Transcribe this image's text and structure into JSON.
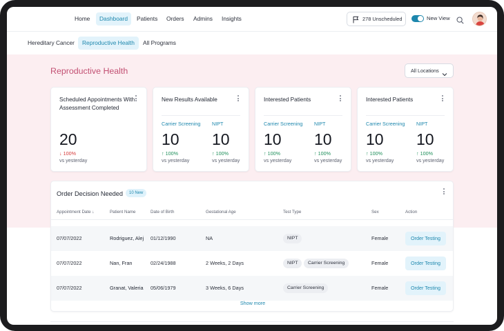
{
  "nav": {
    "items": [
      {
        "label": "Home",
        "active": false
      },
      {
        "label": "Dashboard",
        "active": true
      },
      {
        "label": "Patients",
        "active": false
      },
      {
        "label": "Orders",
        "active": false
      },
      {
        "label": "Admins",
        "active": false
      },
      {
        "label": "Insights",
        "active": false
      }
    ],
    "unscheduled_label": "278 Unscheduled",
    "unscheduled_icon": "flag-icon",
    "toggle": {
      "label": "New View",
      "on": true
    },
    "search_icon": "search-icon",
    "avatar_icon": "user-avatar"
  },
  "programs": {
    "tabs": [
      {
        "label": "Hereditary Cancer",
        "active": false
      },
      {
        "label": "Reproductive Health",
        "active": true
      },
      {
        "label": "All Programs",
        "active": false
      }
    ]
  },
  "page": {
    "title": "Reproductive Health",
    "location_filter": "All Locations"
  },
  "cards": [
    {
      "title": "Scheduled Appointments With Assessment Completed",
      "metrics": [
        {
          "label": "",
          "value": "20",
          "change": "100%",
          "direction": "down",
          "vs": "vs yesterday"
        }
      ]
    },
    {
      "title": "New Results Available",
      "metrics": [
        {
          "label": "Carrier Screening",
          "value": "10",
          "change": "100%",
          "direction": "up",
          "vs": "vs yesterday"
        },
        {
          "label": "NIPT",
          "value": "10",
          "change": "100%",
          "direction": "up",
          "vs": "vs yesterday"
        }
      ]
    },
    {
      "title": "Interested Patients",
      "metrics": [
        {
          "label": "Carrier Screening",
          "value": "10",
          "change": "100%",
          "direction": "up",
          "vs": "vs yesterday"
        },
        {
          "label": "NIPT",
          "value": "10",
          "change": "100%",
          "direction": "up",
          "vs": "vs yesterday"
        }
      ]
    },
    {
      "title": "Interested Patients",
      "metrics": [
        {
          "label": "Carrier Screening",
          "value": "10",
          "change": "100%",
          "direction": "up",
          "vs": "vs yesterday"
        },
        {
          "label": "NIPT",
          "value": "10",
          "change": "100%",
          "direction": "up",
          "vs": "vs yesterday"
        }
      ]
    }
  ],
  "orders": {
    "title": "Order Decision Needed",
    "badge": "10 New",
    "columns": [
      "Appointment Date",
      "Patient Name",
      "Date of Birth",
      "Gestational Age",
      "Test Type",
      "Sex",
      "Action"
    ],
    "rows": [
      {
        "date": "07/07/2022",
        "name": "Rodriguez, Alej",
        "dob": "01/12/1990",
        "ga": "NA",
        "tests": [
          "NIPT"
        ],
        "sex": "Female",
        "action": "Order Testing"
      },
      {
        "date": "07/07/2022",
        "name": "Nan, Fran",
        "dob": "02/24/1988",
        "ga": "2 Weeks, 2 Days",
        "tests": [
          "NIPT",
          "Carrier Screening"
        ],
        "sex": "Female",
        "action": "Order Testing"
      },
      {
        "date": "07/07/2022",
        "name": "Granat, Valeria",
        "dob": "05/06/1979",
        "ga": "3 Weeks, 6 Days",
        "tests": [
          "Carrier Screening"
        ],
        "sex": "Female",
        "action": "Order Testing"
      }
    ],
    "show_more": "Show more"
  },
  "colors": {
    "accent": "#1d87ad",
    "title_pink": "#c24f72",
    "band": "#fceef1",
    "up": "#1e8f5a",
    "down": "#d63a3a"
  }
}
